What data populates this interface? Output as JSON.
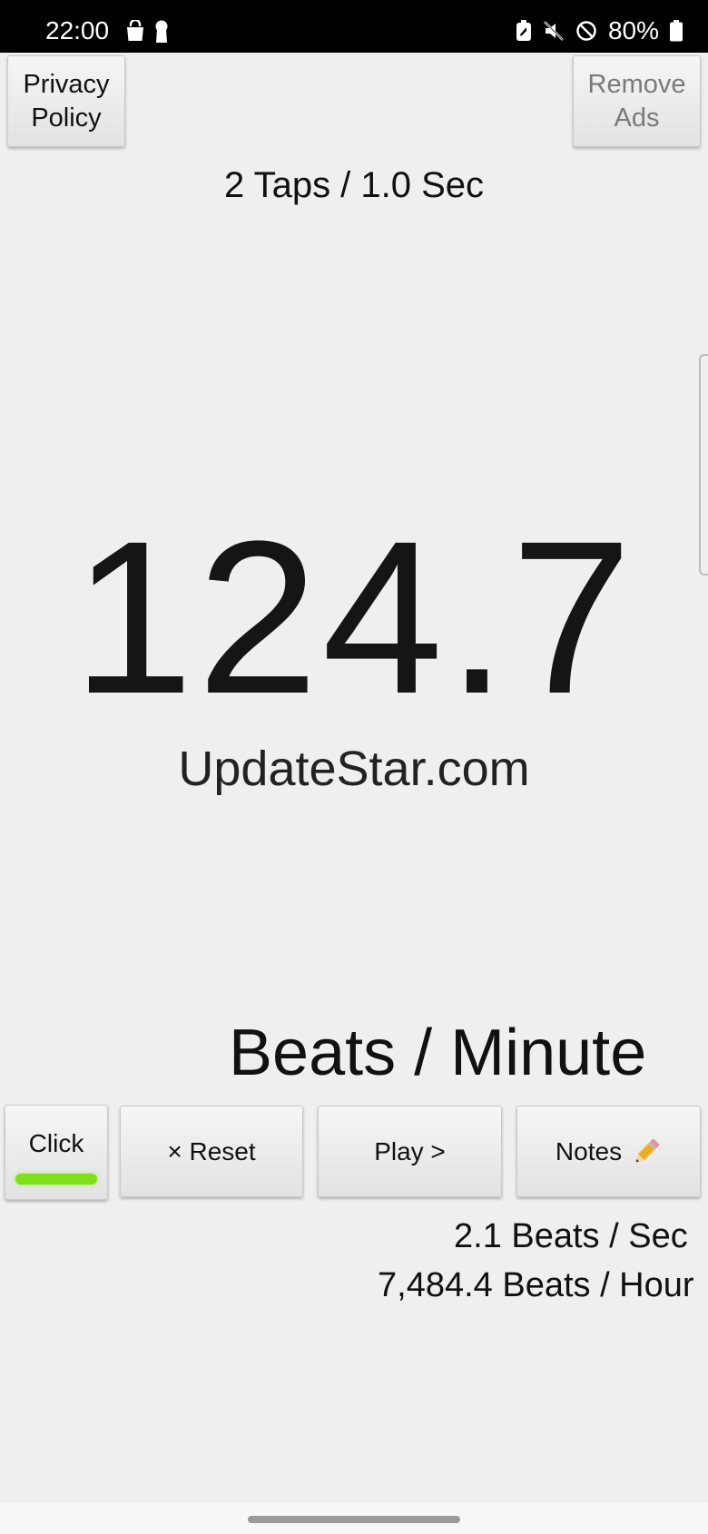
{
  "status_bar": {
    "time": "22:00",
    "battery_percent": "80%",
    "left_icons": [
      "shopping-bag-icon",
      "keyhole-icon"
    ],
    "right_icons": [
      "battery-saver-icon",
      "mute-icon",
      "do-not-disturb-icon",
      "battery-icon"
    ]
  },
  "header": {
    "privacy_button": "Privacy Policy",
    "remove_ads_button": "Remove Ads"
  },
  "taps_info": "2 Taps / 1.0 Sec",
  "bpm_value": "124.7",
  "site_label": "UpdateStar.com",
  "unit_label": "Beats / Minute",
  "buttons": {
    "click": "Click",
    "reset": "× Reset",
    "play": "Play >",
    "notes": "Notes",
    "notes_icon": "pencil-icon"
  },
  "stats": {
    "beats_per_sec": "2.1 Beats / Sec",
    "beats_per_hour": "7,484.4 Beats / Hour"
  },
  "colors": {
    "click_indicator": "#7ee01a",
    "background": "#efefef",
    "status_bar": "#000000"
  }
}
